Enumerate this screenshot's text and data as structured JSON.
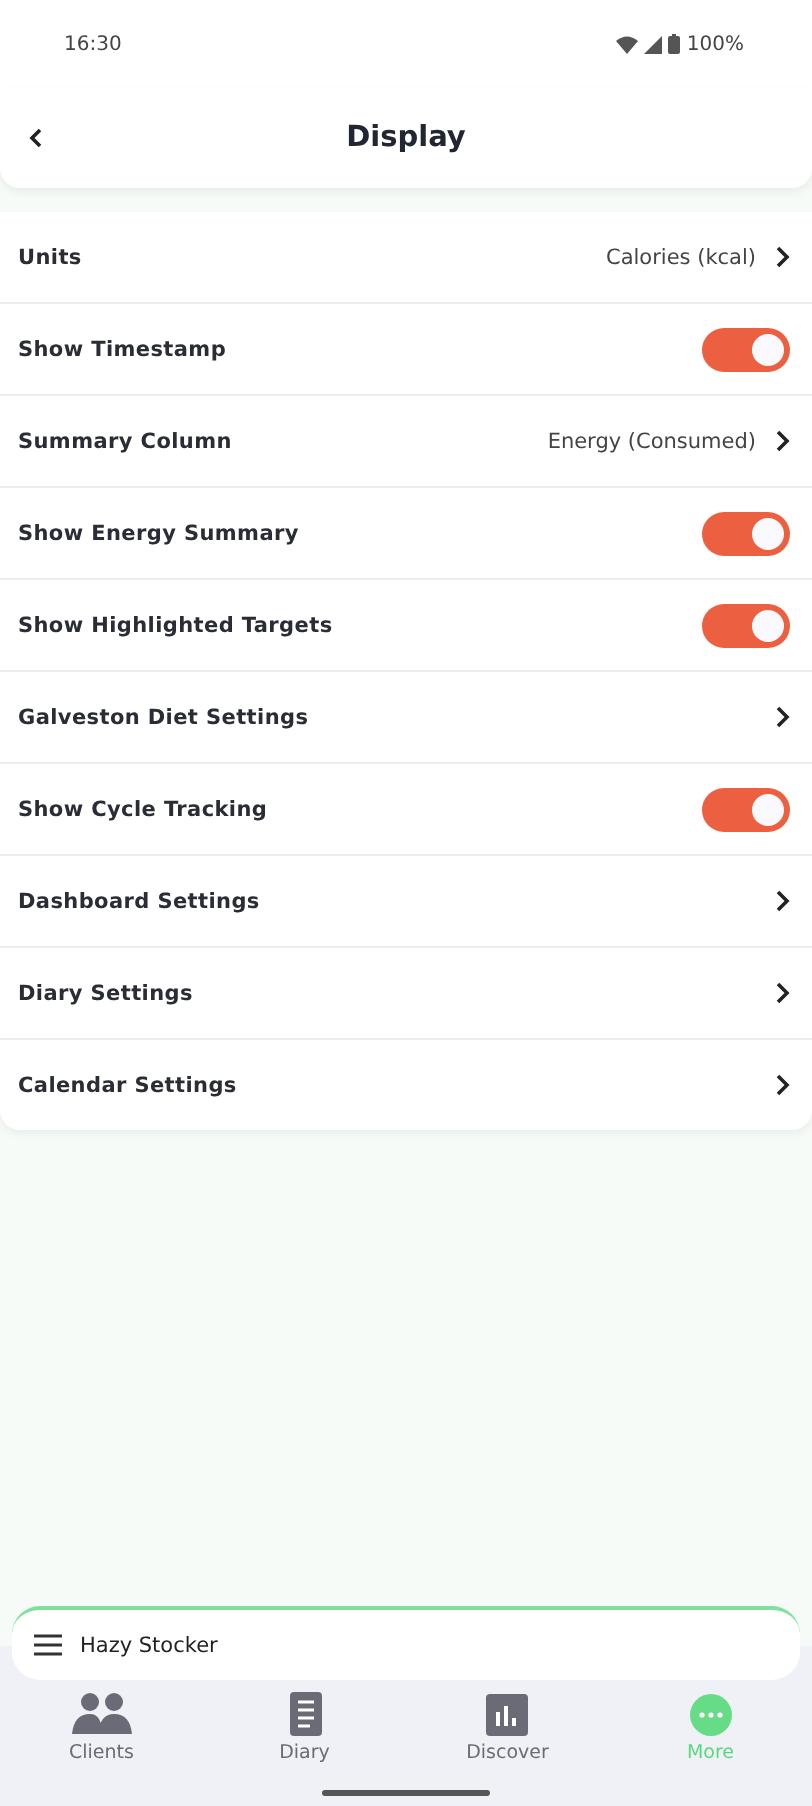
{
  "status_bar": {
    "time": "16:30",
    "battery": "100%"
  },
  "header": {
    "title": "Display"
  },
  "settings": [
    {
      "kind": "link",
      "label": "Units",
      "value": "Calories (kcal)"
    },
    {
      "kind": "toggle",
      "label": "Show Timestamp",
      "on": true
    },
    {
      "kind": "link",
      "label": "Summary Column",
      "value": "Energy (Consumed)"
    },
    {
      "kind": "toggle",
      "label": "Show Energy Summary",
      "on": true
    },
    {
      "kind": "toggle",
      "label": "Show Highlighted Targets",
      "on": true
    },
    {
      "kind": "link",
      "label": "Galveston Diet Settings"
    },
    {
      "kind": "toggle",
      "label": "Show Cycle Tracking",
      "on": true
    },
    {
      "kind": "link",
      "label": "Dashboard Settings"
    },
    {
      "kind": "link",
      "label": "Diary Settings"
    },
    {
      "kind": "link",
      "label": "Calendar Settings"
    }
  ],
  "client_bar": {
    "name": "Hazy Stocker"
  },
  "nav": [
    {
      "kind": "people",
      "label": "Clients",
      "selected": false
    },
    {
      "kind": "notebook",
      "label": "Diary",
      "selected": false
    },
    {
      "kind": "chart",
      "label": "Discover",
      "selected": false
    },
    {
      "kind": "more",
      "label": "More",
      "selected": true
    }
  ]
}
